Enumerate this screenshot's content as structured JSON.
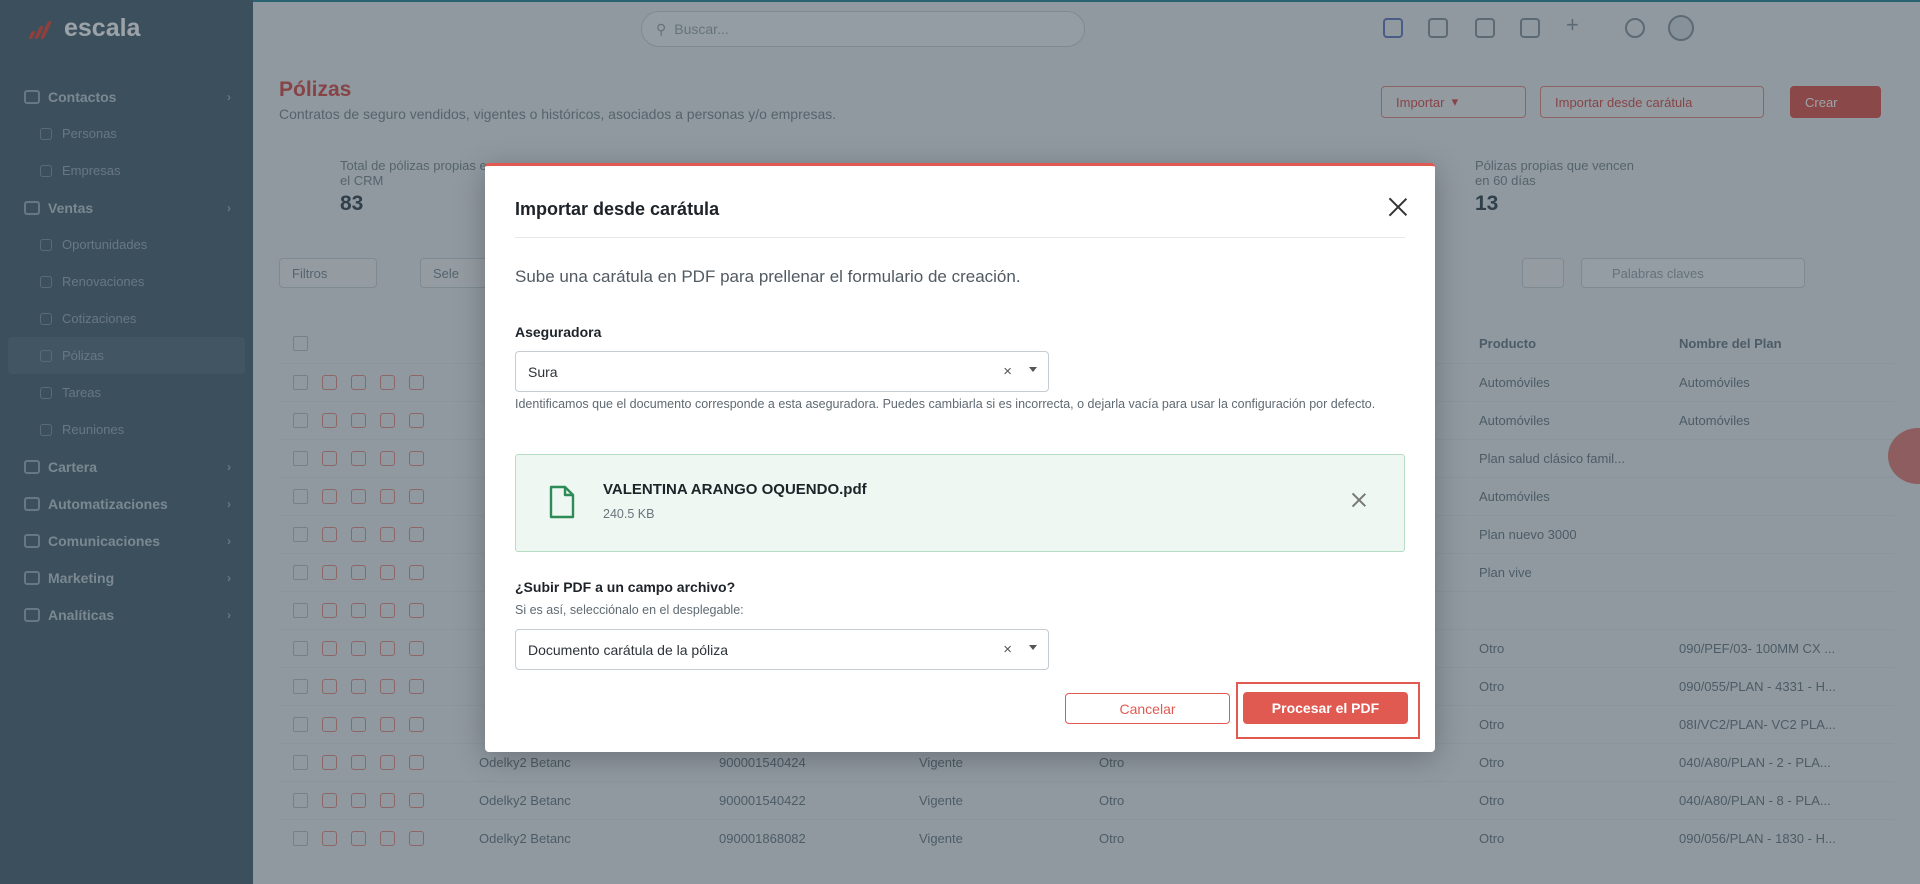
{
  "app": {
    "name": "escala"
  },
  "sidebar": {
    "items": [
      {
        "label": "Contactos",
        "type": "group",
        "icon": "contacts-icon"
      },
      {
        "label": "Personas",
        "type": "sub",
        "icon": "person-icon"
      },
      {
        "label": "Empresas",
        "type": "sub",
        "icon": "building-icon"
      },
      {
        "label": "Ventas",
        "type": "group",
        "icon": "sales-icon"
      },
      {
        "label": "Oportunidades",
        "type": "sub",
        "icon": "opportunity-icon"
      },
      {
        "label": "Renovaciones",
        "type": "sub",
        "icon": "renewal-icon"
      },
      {
        "label": "Cotizaciones",
        "type": "sub",
        "icon": "quote-icon"
      },
      {
        "label": "Pólizas",
        "type": "sub",
        "icon": "policy-icon",
        "active": true
      },
      {
        "label": "Tareas",
        "type": "sub",
        "icon": "task-icon"
      },
      {
        "label": "Reuniones",
        "type": "sub",
        "icon": "meeting-icon"
      },
      {
        "label": "Cartera",
        "type": "group",
        "icon": "wallet-icon"
      },
      {
        "label": "Automatizaciones",
        "type": "group",
        "icon": "bolt-icon"
      },
      {
        "label": "Comunicaciones",
        "type": "group",
        "icon": "chat-icon"
      },
      {
        "label": "Marketing",
        "type": "group",
        "icon": "star-icon"
      },
      {
        "label": "Analíticas",
        "type": "group",
        "icon": "chart-icon"
      }
    ]
  },
  "topbar": {
    "search_placeholder": "Buscar..."
  },
  "page": {
    "title": "Pólizas",
    "subtitle": "Contratos de seguro vendidos, vigentes o históricos, asociados a personas y/o empresas.",
    "buttons": {
      "import": "Importar",
      "import_cover": "Importar desde carátula",
      "create": "Crear"
    },
    "stats": [
      {
        "label_line1": "Total de pólizas propias en",
        "label_line2": "el CRM",
        "value": "83"
      },
      {
        "label_line1": "Pólizas propias que vencen",
        "label_line2": "en 60 días",
        "value": "13"
      }
    ],
    "toolbar": {
      "filters": "Filtros",
      "select": "Sele",
      "keyword_placeholder": "Palabras claves"
    }
  },
  "table": {
    "headers": {
      "product": "Producto",
      "plan": "Nombre del Plan"
    },
    "rows": [
      {
        "name": "",
        "number": "",
        "status": "",
        "type": "",
        "product": "Automóviles",
        "plan": "Automóviles"
      },
      {
        "name": "",
        "number": "",
        "status": "",
        "type": "",
        "product": "Automóviles",
        "plan": "Automóviles"
      },
      {
        "name": "",
        "number": "",
        "status": "",
        "type": "",
        "product": "Plan salud clásico famil...",
        "plan": ""
      },
      {
        "name": "",
        "number": "",
        "status": "",
        "type": "",
        "product": "Automóviles",
        "plan": ""
      },
      {
        "name": "",
        "number": "",
        "status": "",
        "type": "",
        "product": "Plan nuevo 3000",
        "plan": ""
      },
      {
        "name": "",
        "number": "",
        "status": "",
        "type": "",
        "product": "Plan vive",
        "plan": ""
      },
      {
        "name": "",
        "number": "",
        "status": "",
        "type": "",
        "product": "",
        "plan": ""
      },
      {
        "name": "",
        "number": "",
        "status": "",
        "type": "",
        "product": "Otro",
        "plan": "090/PEF/03- 100MM CX ..."
      },
      {
        "name": "",
        "number": "",
        "status": "",
        "type": "",
        "product": "Otro",
        "plan": "090/055/PLAN - 4331 - H..."
      },
      {
        "name": "",
        "number": "",
        "status": "",
        "type": "",
        "product": "Otro",
        "plan": "08I/VC2/PLAN- VC2 PLA..."
      },
      {
        "name": "Odelky2 Betanc",
        "number": "900001540424",
        "status": "Vigente",
        "type": "Otro",
        "product": "Otro",
        "plan": "040/A80/PLAN - 2 - PLA..."
      },
      {
        "name": "Odelky2 Betanc",
        "number": "900001540422",
        "status": "Vigente",
        "type": "Otro",
        "product": "Otro",
        "plan": "040/A80/PLAN - 8 - PLA..."
      },
      {
        "name": "Odelky2 Betanc",
        "number": "090001868082",
        "status": "Vigente",
        "type": "Otro",
        "product": "Otro",
        "plan": "090/056/PLAN - 1830 - H..."
      }
    ]
  },
  "modal": {
    "title": "Importar desde carátula",
    "intro": "Sube una carátula en PDF para prellenar el formulario de creación.",
    "insurer_label": "Aseguradora",
    "insurer_value": "Sura",
    "insurer_help": "Identificamos que el documento corresponde a esta aseguradora. Puedes cambiarla si es incorrecta, o dejarla vacía para usar la configuración por defecto.",
    "file": {
      "name": "VALENTINA ARANGO OQUENDO.pdf",
      "size": "240.5 KB"
    },
    "upload_label": "¿Subir PDF a un campo archivo?",
    "upload_help": "Si es así, selecciónalo en el desplegable:",
    "upload_value": "Documento carátula de la póliza",
    "clear_glyph": "×",
    "cancel": "Cancelar",
    "process": "Procesar el PDF"
  },
  "colors": {
    "accent": "#e05a52",
    "sidebar": "#4f6675",
    "file_bg": "#eef7f1",
    "file_icon": "#2e8b57"
  }
}
